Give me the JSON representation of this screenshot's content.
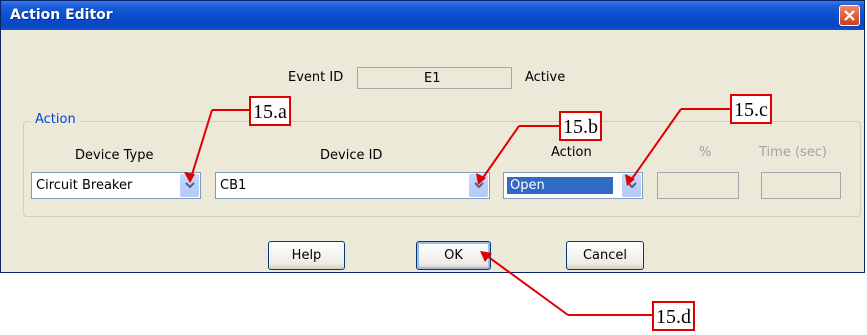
{
  "window": {
    "title": "Action Editor"
  },
  "event": {
    "label": "Event ID",
    "value": "E1",
    "status": "Active"
  },
  "action_group": {
    "legend": "Action",
    "headers": {
      "device_type": "Device Type",
      "device_id": "Device ID",
      "action": "Action",
      "percent": "%",
      "time": "Time (sec)"
    },
    "device_type_value": "Circuit Breaker",
    "device_id_value": "CB1",
    "action_value": "Open",
    "percent_value": "",
    "time_value": ""
  },
  "buttons": {
    "help": "Help",
    "ok": "OK",
    "cancel": "Cancel"
  },
  "callouts": {
    "a": "15.a",
    "b": "15.b",
    "c": "15.c",
    "d": "15.d"
  },
  "colors": {
    "title_bar": "#0a4fd0",
    "callout_border": "#e00000",
    "selection": "#316ac5"
  }
}
